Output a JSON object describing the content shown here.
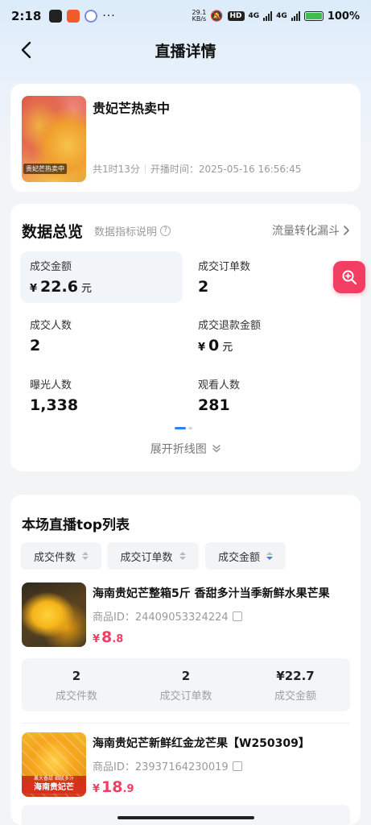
{
  "status_bar": {
    "time": "2:18",
    "net_speed_value": "29.1",
    "net_speed_unit": "KB/s",
    "hd": "HD",
    "net1": "4G",
    "net2": "4G",
    "battery": "100%"
  },
  "nav": {
    "title": "直播详情"
  },
  "live": {
    "name": "贵妃芒热卖中",
    "thumb_caption": "贵妃芒热卖中",
    "duration": "共1时13分",
    "start_time": "开播时间：2025-05-16 16:56:45"
  },
  "overview": {
    "title": "数据总览",
    "help": "数据指标说明",
    "funnel": "流量转化漏斗",
    "metrics": [
      {
        "label": "成交金额",
        "currency": "¥",
        "value": "22.6",
        "unit": "元"
      },
      {
        "label": "成交订单数",
        "value": "2"
      },
      {
        "label": "成交人数",
        "value": "2"
      },
      {
        "label": "成交退款金额",
        "currency": "¥",
        "value": "0",
        "unit": "元"
      },
      {
        "label": "曝光人数",
        "value": "1,338"
      },
      {
        "label": "观看人数",
        "value": "281"
      }
    ],
    "expand": "展开折线图"
  },
  "top_list": {
    "title": "本场直播top列表",
    "sorts": [
      "成交件数",
      "成交订单数",
      "成交金额"
    ],
    "active_sort": "成交金额",
    "products": [
      {
        "name": "海南贵妃芒整箱5斤 香甜多汁当季新鲜水果芒果",
        "id": "商品ID：24409053324224",
        "price_currency": "¥",
        "price_int": "8",
        "price_dec": ".8",
        "stats": [
          {
            "value": "2",
            "label": "成交件数"
          },
          {
            "value": "2",
            "label": "成交订单数"
          },
          {
            "value": "¥22.7",
            "label": "成交金额"
          }
        ]
      },
      {
        "name": "海南贵妃芒新鲜红金龙芒果【W250309】",
        "id": "商品ID：23937164230019",
        "price_currency": "¥",
        "price_int": "18",
        "price_dec": ".9",
        "img_tag": "海南贵妃芒",
        "img_sub": "果大香甜 细腻多汁"
      }
    ]
  },
  "colors": {
    "accent": "#f23e63",
    "sort_active": "#2f7ef6",
    "metric_active_bg": "#f1f5fa"
  }
}
